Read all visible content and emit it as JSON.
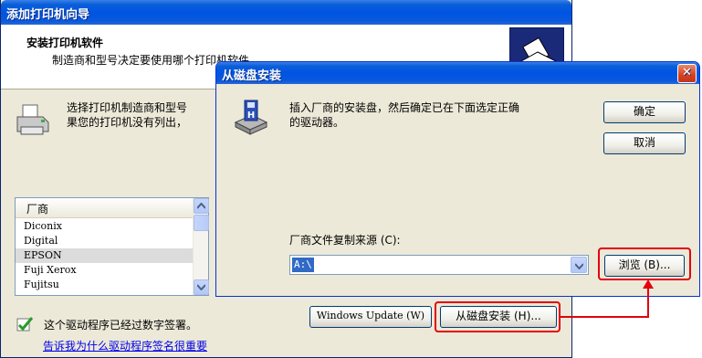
{
  "wizard": {
    "title": "添加打印机向导",
    "header_title": "安装打印机软件",
    "header_subtitle": "制造商和型号决定要使用哪个打印机软件。",
    "body_text_line1": "选择打印机制造商和型号",
    "body_text_line2": "果您的打印机没有列出，",
    "manufacturer_header": "厂商",
    "manufacturers": [
      "Diconix",
      "Digital",
      "EPSON",
      "Fuji Xerox",
      "Fujitsu"
    ],
    "selected_manufacturer": "EPSON",
    "signed_text": "这个驱动程序已经过数字签署。",
    "why_link": "告诉我为什么驱动程序签名很重要",
    "windows_update_label": "Windows Update (W)",
    "from_disk_label": "从磁盘安装 (H)..."
  },
  "dialog": {
    "title": "从磁盘安装",
    "close_label": "✕",
    "message_line1": "插入厂商的安装盘，然后确定已在下面选定正确",
    "message_line2": "的驱动器。",
    "ok_label": "确定",
    "cancel_label": "取消",
    "source_label": "厂商文件复制来源 (C):",
    "source_value": "A:\\",
    "browse_label": "浏览 (B)..."
  },
  "colors": {
    "title_blue": "#0054e3",
    "highlight_red": "#e3000f",
    "selection_blue": "#316ac5"
  }
}
